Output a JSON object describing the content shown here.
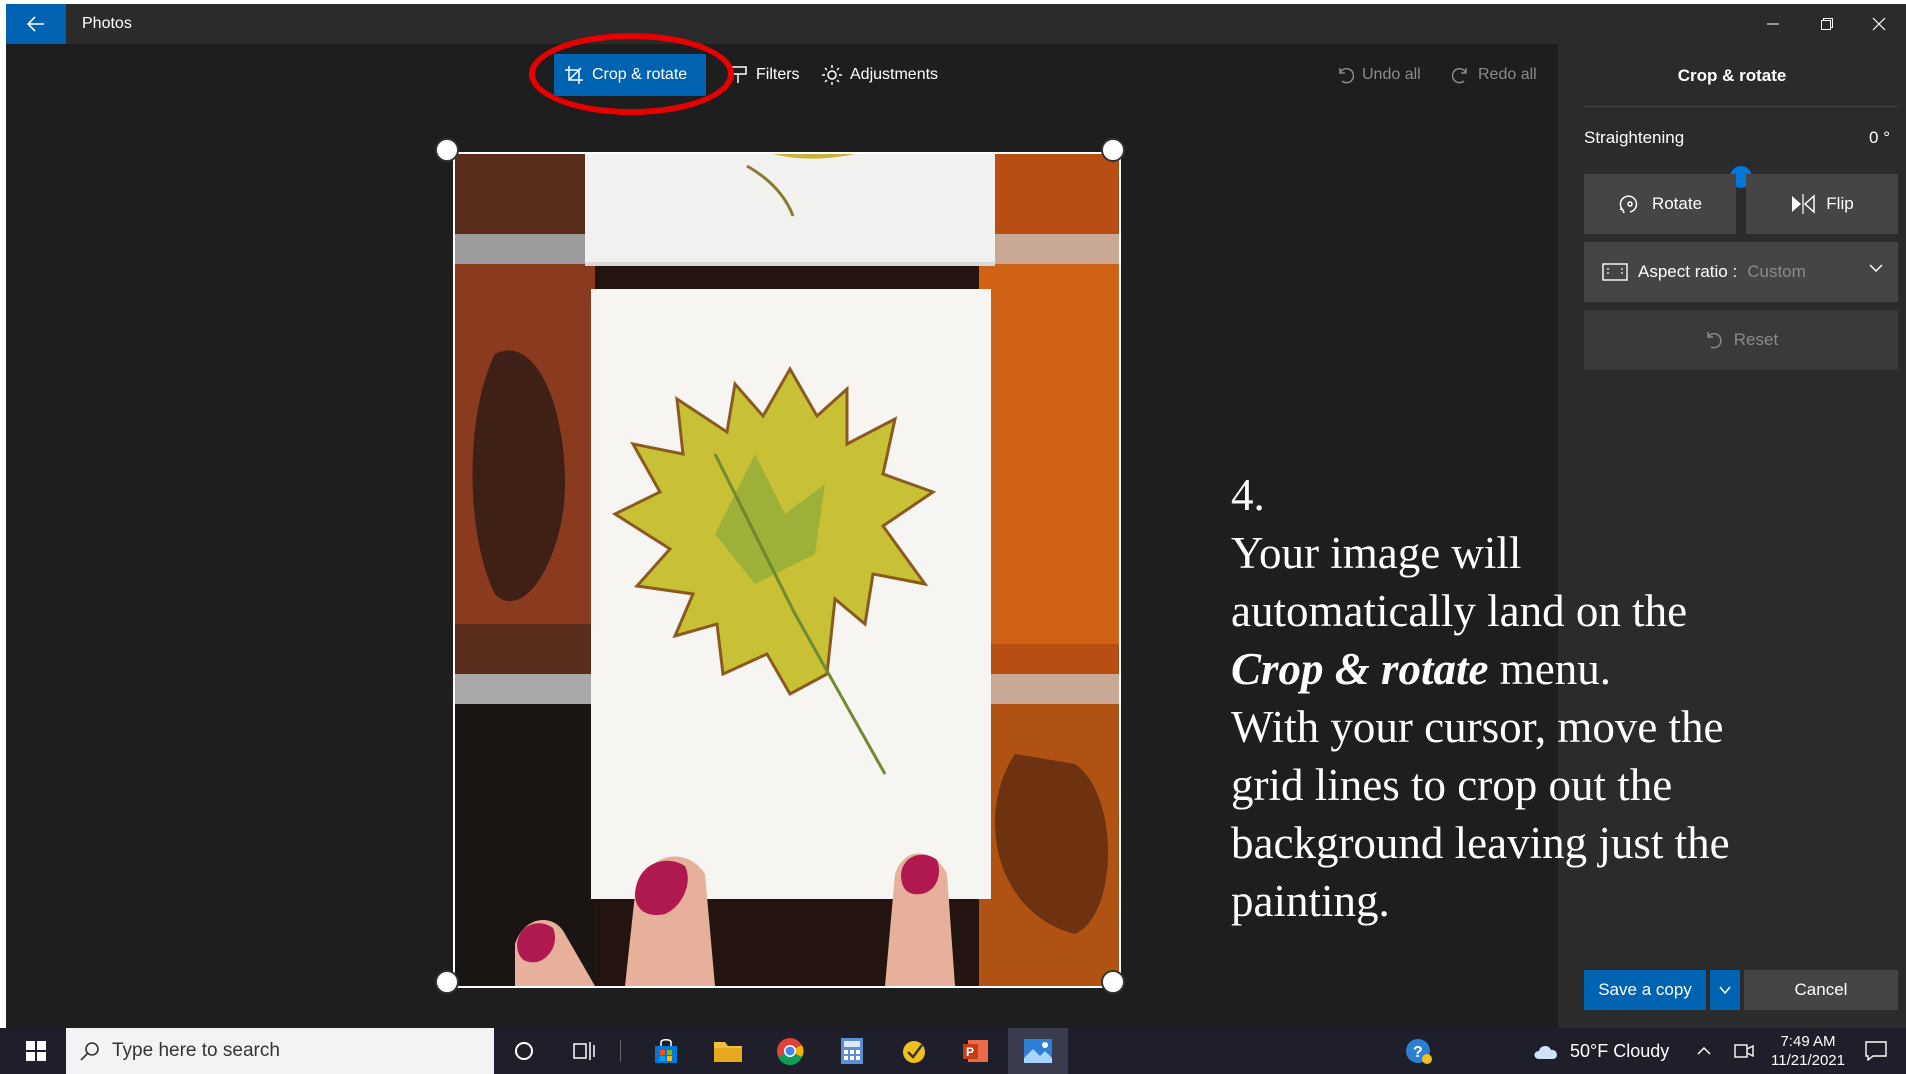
{
  "window": {
    "app_title": "Photos",
    "icons": {
      "back": "arrow-left-icon",
      "minimize": "minimize-icon",
      "restore": "restore-icon",
      "close": "close-icon"
    }
  },
  "toolbar": {
    "crop_rotate": "Crop & rotate",
    "filters": "Filters",
    "adjustments": "Adjustments",
    "undo_all": "Undo all",
    "redo_all": "Redo all"
  },
  "panel": {
    "title": "Crop & rotate",
    "straightening_label": "Straightening",
    "straightening_value": "0 °",
    "straightening_level": 0.5,
    "rotate": "Rotate",
    "flip": "Flip",
    "aspect_ratio_label": "Aspect ratio :",
    "aspect_ratio_value": "Custom",
    "reset": "Reset",
    "save_copy": "Save a copy",
    "cancel": "Cancel"
  },
  "caption": {
    "line1": "4.",
    "line2": "Your image will automatically land on the",
    "emphasis": "Crop & rotate",
    "line3": " menu.",
    "line4": "With your cursor, move the grid lines to crop out the background leaving just the painting."
  },
  "taskbar": {
    "search_placeholder": "Type here to search",
    "weather": "50°F  Cloudy",
    "time": "7:49 AM",
    "date": "11/21/2021"
  },
  "colors": {
    "accent": "#0063b1",
    "annotation_ring": "#e60000",
    "app_bg": "#1e1e1e",
    "panel_bg": "#2b2b2b"
  }
}
